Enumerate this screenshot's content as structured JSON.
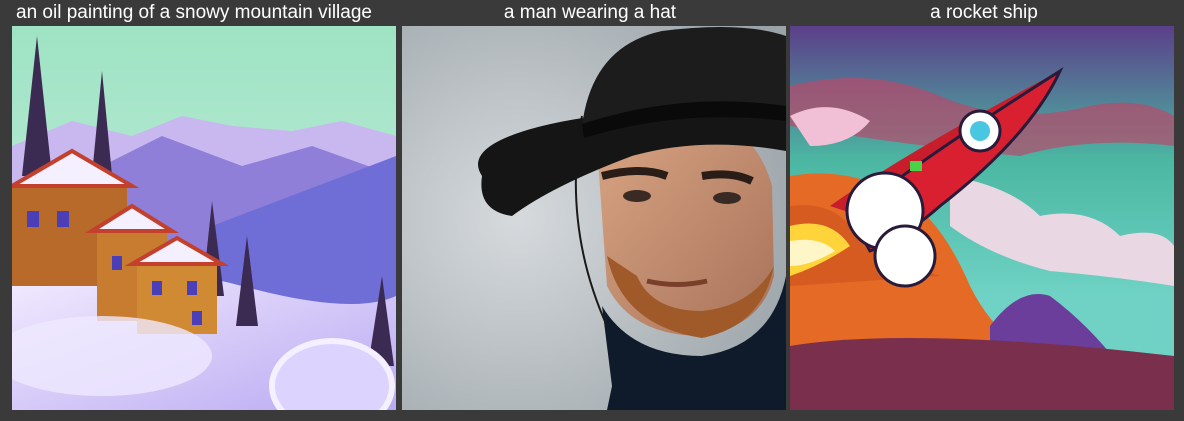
{
  "panels": [
    {
      "caption": "an oil painting of a snowy mountain village",
      "image": "snowy-mountain-village-painting"
    },
    {
      "caption": "a man wearing a hat",
      "image": "man-in-black-hat-photo"
    },
    {
      "caption": "a rocket ship",
      "image": "cartoon-rocket-ship"
    }
  ],
  "colors": {
    "background": "#3a3a3a",
    "caption_text": "#ffffff"
  }
}
